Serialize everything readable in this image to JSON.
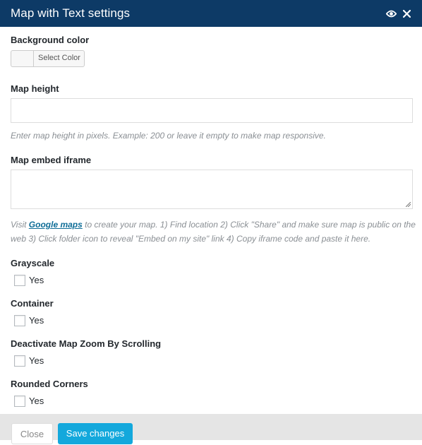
{
  "dialog": {
    "title": "Map with Text settings",
    "icons": {
      "toggle": "eye-icon",
      "close": "close-icon"
    }
  },
  "fields": {
    "background_color": {
      "label": "Background color",
      "button_label": "Select Color"
    },
    "map_height": {
      "label": "Map height",
      "value": "",
      "description": "Enter map height in pixels. Example: 200 or leave it empty to make map responsive."
    },
    "map_embed": {
      "label": "Map embed iframe",
      "value": "",
      "description_prefix": "Visit ",
      "description_link": "Google maps",
      "description_suffix": " to create your map. 1) Find location 2) Click \"Share\" and make sure map is public on the web 3) Click folder icon to reveal \"Embed on my site\" link 4) Copy iframe code and paste it here."
    },
    "grayscale": {
      "label": "Grayscale",
      "option": "Yes",
      "checked": false
    },
    "container": {
      "label": "Container",
      "option": "Yes",
      "checked": false
    },
    "deactivate_zoom": {
      "label": "Deactivate Map Zoom By Scrolling",
      "option": "Yes",
      "checked": false
    },
    "rounded_corners": {
      "label": "Rounded Corners",
      "option": "Yes",
      "checked": false
    }
  },
  "footer": {
    "close_label": "Close",
    "save_label": "Save changes"
  },
  "colors": {
    "header": "#0d3a66",
    "save_button": "#13a8dc",
    "link": "#0e6d97",
    "footer": "#e5e5e5"
  }
}
